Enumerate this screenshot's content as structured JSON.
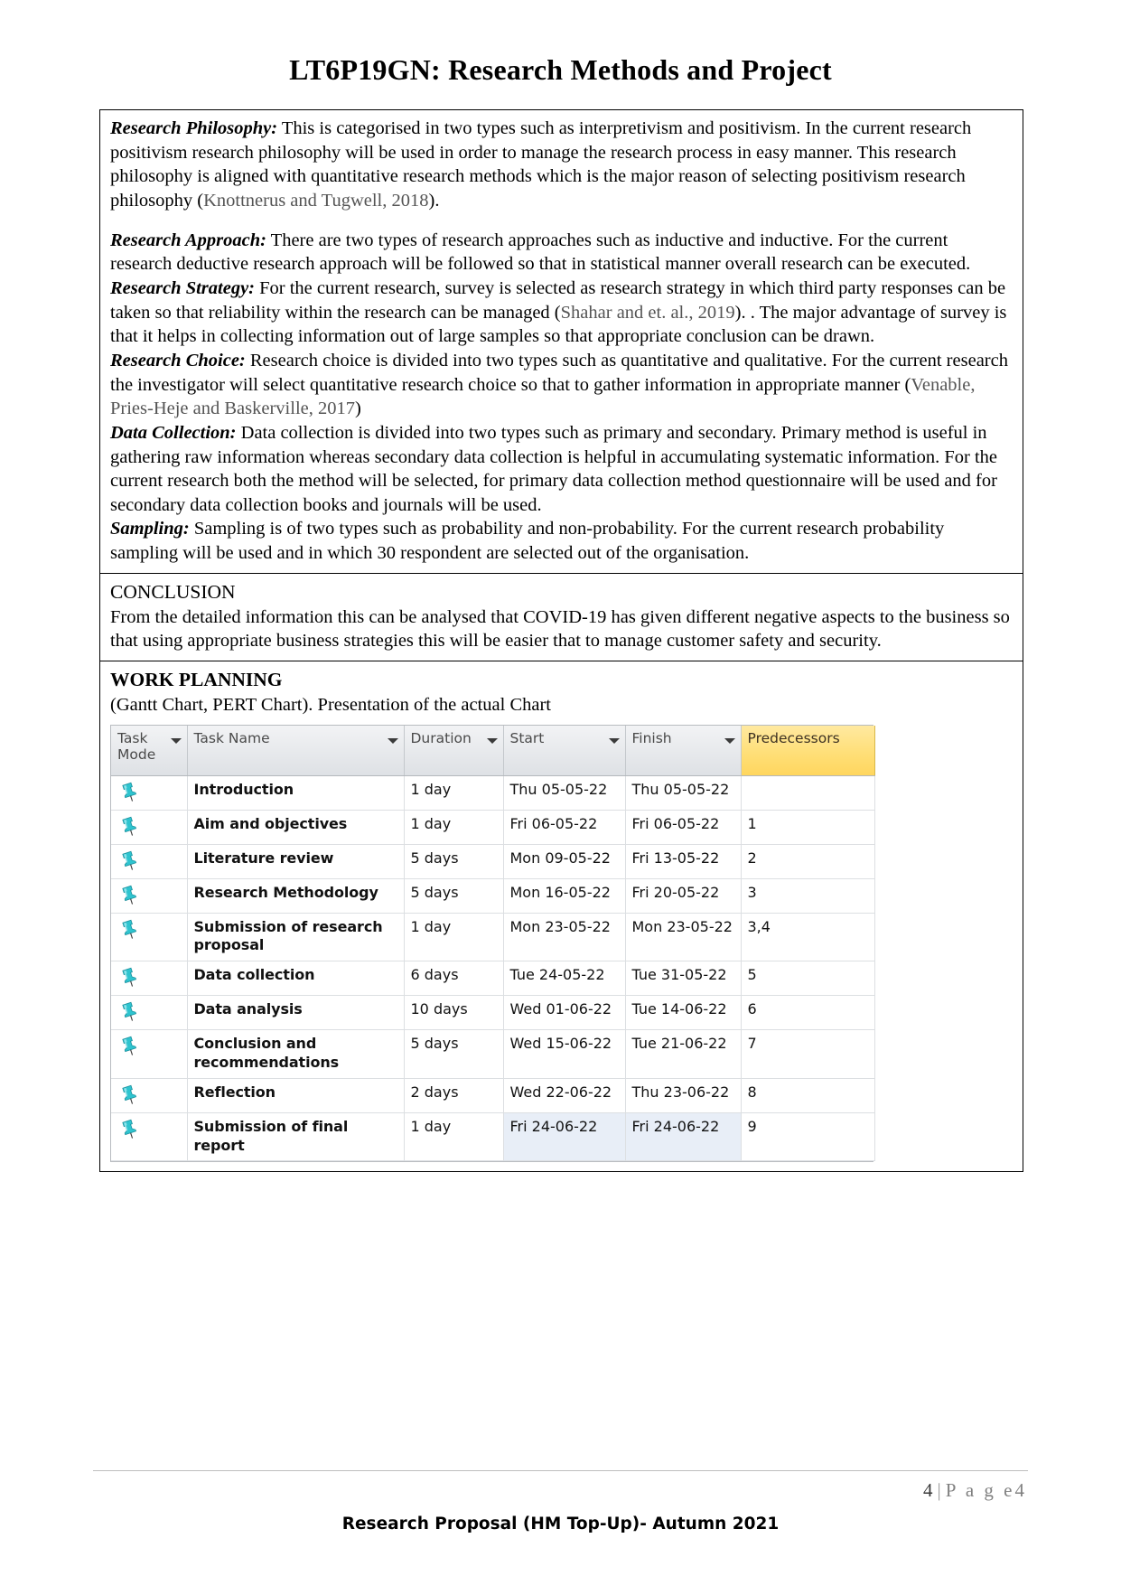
{
  "document": {
    "title": "LT6P19GN: Research Methods and Project"
  },
  "sections": [
    {
      "lead": "Research Philosophy:",
      "text_before_cite": " This is categorised in two types such as interpretivism and positivism. In the current research positivism research philosophy will be used in order to manage the research process in easy manner. This research philosophy is aligned with quantitative research methods which is the major reason of selecting positivism research philosophy (",
      "cite": "Knottnerus and Tugwell, 2018",
      "text_after_cite": ")."
    },
    {
      "lead": "Research Approach:",
      "text_before_cite": " There are two types of research approaches such as inductive and inductive. For the current research deductive research approach will be followed so that in statistical manner overall research can be executed.",
      "cite": "",
      "text_after_cite": ""
    },
    {
      "lead": "Research Strategy:",
      "text_before_cite": " For the current research, survey is selected as research strategy in which third party responses can be taken so that reliability within the research can be managed (",
      "cite": "Shahar and et. al., 2019",
      "text_after_cite": "). . The major advantage of survey is that it  helps in collecting information out of large samples so that appropriate conclusion can be drawn."
    },
    {
      "lead": "Research Choice:",
      "text_before_cite": " Research choice is divided into two types such as quantitative and qualitative. For the current research the investigator will select quantitative research choice so that to gather information in appropriate manner (",
      "cite": "Venable, Pries-Heje and Baskerville, 2017",
      "text_after_cite": ")"
    },
    {
      "lead": "Data Collection:",
      "text_before_cite": " Data collection is divided into two types such as primary and secondary. Primary method is useful in gathering raw information whereas secondary data collection is helpful in accumulating systematic information. For the current research both the method will be selected, for primary data collection method questionnaire will be used and for secondary data collection books and journals will be used.",
      "cite": "",
      "text_after_cite": ""
    },
    {
      "lead": "Sampling:",
      "text_before_cite": " Sampling is of two types such as probability and non-probability. For the current research probability sampling will be used and in which 30 respondent are selected out of the organisation.",
      "cite": "",
      "text_after_cite": ""
    }
  ],
  "conclusion": {
    "heading": "CONCLUSION",
    "body": "From the detailed information this can be analysed that COVID-19 has given different negative aspects to the business so that using appropriate business strategies this will be easier that to manage customer safety and security."
  },
  "work_planning": {
    "heading": "WORK PLANNING",
    "subheading": "(Gantt Chart, PERT Chart). Presentation of the actual Chart"
  },
  "gantt": {
    "columns": [
      {
        "label": "Task Mode",
        "has_filter": true,
        "highlight": false
      },
      {
        "label": "Task Name",
        "has_filter": true,
        "highlight": false
      },
      {
        "label": "Duration",
        "has_filter": true,
        "highlight": false
      },
      {
        "label": "Start",
        "has_filter": true,
        "highlight": false
      },
      {
        "label": "Finish",
        "has_filter": true,
        "highlight": false
      },
      {
        "label": "Predecessors",
        "has_filter": true,
        "highlight": true
      }
    ],
    "header_highlight_color": "#ffdf78",
    "selected_row_color": "#e8eef7",
    "pin_icon_color": "#2ec4cf",
    "rows": [
      {
        "mode_icon": "pushpin-icon",
        "name": "Introduction",
        "duration": "1 day",
        "start": "Thu 05-05-22",
        "finish": "Thu 05-05-22",
        "predecessors": "",
        "selected": false
      },
      {
        "mode_icon": "pushpin-icon",
        "name": "Aim and objectives",
        "duration": "1 day",
        "start": "Fri 06-05-22",
        "finish": "Fri 06-05-22",
        "predecessors": "1",
        "selected": false
      },
      {
        "mode_icon": "pushpin-icon",
        "name": "Literature review",
        "duration": "5 days",
        "start": "Mon 09-05-22",
        "finish": "Fri 13-05-22",
        "predecessors": "2",
        "selected": false
      },
      {
        "mode_icon": "pushpin-icon",
        "name": "Research Methodology",
        "duration": "5 days",
        "start": "Mon 16-05-22",
        "finish": "Fri 20-05-22",
        "predecessors": "3",
        "selected": false
      },
      {
        "mode_icon": "pushpin-icon",
        "name": "Submission of research proposal",
        "duration": "1 day",
        "start": "Mon 23-05-22",
        "finish": "Mon 23-05-22",
        "predecessors": "3,4",
        "selected": false
      },
      {
        "mode_icon": "pushpin-icon",
        "name": "Data collection",
        "duration": "6 days",
        "start": "Tue 24-05-22",
        "finish": "Tue 31-05-22",
        "predecessors": "5",
        "selected": false
      },
      {
        "mode_icon": "pushpin-icon",
        "name": "Data analysis",
        "duration": "10 days",
        "start": "Wed 01-06-22",
        "finish": "Tue 14-06-22",
        "predecessors": "6",
        "selected": false
      },
      {
        "mode_icon": "pushpin-icon",
        "name": "Conclusion and recommendations",
        "duration": "5 days",
        "start": "Wed 15-06-22",
        "finish": "Tue 21-06-22",
        "predecessors": "7",
        "selected": false
      },
      {
        "mode_icon": "pushpin-icon",
        "name": "Reflection",
        "duration": "2 days",
        "start": "Wed 22-06-22",
        "finish": "Thu 23-06-22",
        "predecessors": "8",
        "selected": false
      },
      {
        "mode_icon": "pushpin-icon",
        "name": "Submission of final report",
        "duration": "1 day",
        "start": "Fri 24-06-22",
        "finish": "Fri 24-06-22",
        "predecessors": "9",
        "selected": true
      }
    ]
  },
  "footer": {
    "page_number": "4",
    "separator": "|",
    "page_word": "P a g e",
    "page_word_trailing": "4",
    "note": "Research Proposal (HM Top-Up)- Autumn 2021"
  }
}
